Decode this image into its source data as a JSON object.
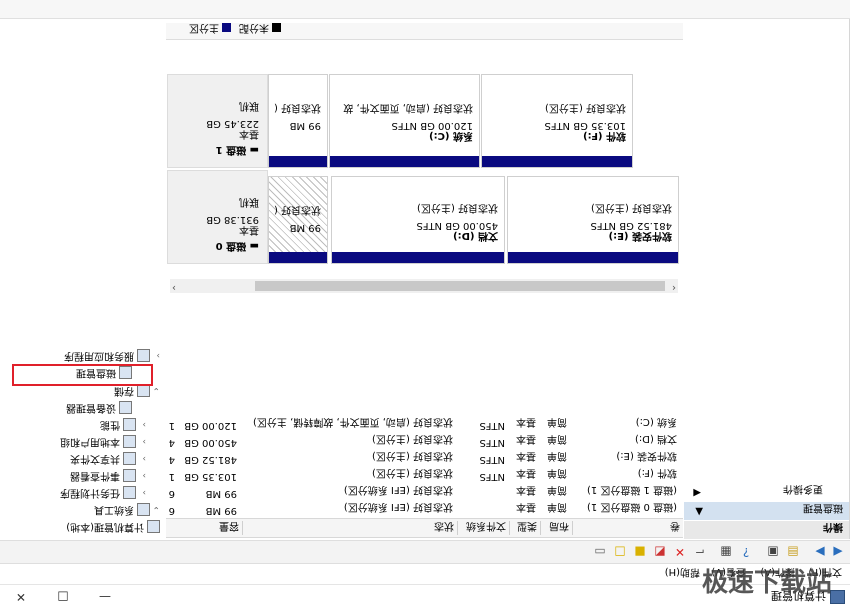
{
  "window": {
    "title": "计算机管理",
    "min": "—",
    "max": "□",
    "close": "✕"
  },
  "menu": {
    "items": [
      "文件(F)",
      "操作(A)",
      "查看(V)",
      "帮助(H)"
    ]
  },
  "toolbar": {
    "icons": [
      "back-arrow-icon",
      "forward-arrow-icon",
      "up-folder-icon",
      "properties-icon",
      "help-icon",
      "refresh-icon",
      "connect-icon",
      "delete-icon",
      "shrink-icon",
      "folder-icon",
      "folder-open-icon",
      "console-icon"
    ]
  },
  "tree": {
    "root": "计算机管理(本地)",
    "system_tools": "系统工具",
    "task_scheduler": "任务计划程序",
    "event_viewer": "事件查看器",
    "shared_folders": "共享文件夹",
    "local_users": "本地用户和组",
    "performance": "性能",
    "device_manager": "设备管理器",
    "storage": "存储",
    "disk_management": "磁盘管理",
    "services_apps": "服务和应用程序"
  },
  "volume_table": {
    "headers": [
      "卷",
      "布局",
      "类型",
      "文件系统",
      "状态",
      "容量"
    ],
    "rows": [
      [
        "(磁盘 0 磁盘分区 1)",
        "简单",
        "基本",
        "",
        "状态良好 (EFI 系统分区)",
        "99 MB",
        "6"
      ],
      [
        "(磁盘 1 磁盘分区 1)",
        "简单",
        "基本",
        "",
        "状态良好 (EFI 系统分区)",
        "99 MB",
        "6"
      ],
      [
        "软件 (F:)",
        "简单",
        "基本",
        "NTFS",
        "状态良好 (主分区)",
        "103.35 GB",
        "1"
      ],
      [
        "软件安装 (E:)",
        "简单",
        "基本",
        "NTFS",
        "状态良好 (主分区)",
        "481.52 GB",
        "4"
      ],
      [
        "文档 (D:)",
        "简单",
        "基本",
        "NTFS",
        "状态良好 (主分区)",
        "450.00 GB",
        "4"
      ],
      [
        "系统 (C:)",
        "简单",
        "基本",
        "NTFS",
        "状态良好 (启动, 页面文件, 故障转储, 主分区)",
        "120.00 GB",
        "1"
      ]
    ]
  },
  "disks": [
    {
      "name": "磁盘 0",
      "type": "基本",
      "size": "931.38 GB",
      "status": "联机",
      "partitions": [
        {
          "size": "99 MB",
          "status": "状态良好 (",
          "label": "",
          "hatched": true
        },
        {
          "size": "450.00 GB NTFS",
          "status": "状态良好 (主分区)",
          "label": "文档 (D:)",
          "hatched": false
        },
        {
          "size": "481.52 GB NTFS",
          "status": "状态良好 (主分区)",
          "label": "软件安装 (E:)",
          "hatched": false
        }
      ]
    },
    {
      "name": "磁盘 1",
      "type": "基本",
      "size": "223.45 GB",
      "status": "联机",
      "partitions": [
        {
          "size": "99 MB",
          "status": "状态良好 (",
          "label": "",
          "hatched": false
        },
        {
          "size": "120.00 GB NTFS",
          "status": "状态良好 (启动, 页面文件, 故",
          "label": "系统 (C:)",
          "hatched": false
        },
        {
          "size": "103.35 GB NTFS",
          "status": "状态良好 (主分区)",
          "label": "软件 (F:)",
          "hatched": false
        }
      ]
    }
  ],
  "legend": {
    "unallocated": "未分配",
    "primary": "主分区",
    "unallocated_color": "#000000",
    "primary_color": "#0a0a80"
  },
  "actions": {
    "header": "操作",
    "section": "磁盘管理",
    "more": "更多操作"
  },
  "watermark": "极速下载站"
}
